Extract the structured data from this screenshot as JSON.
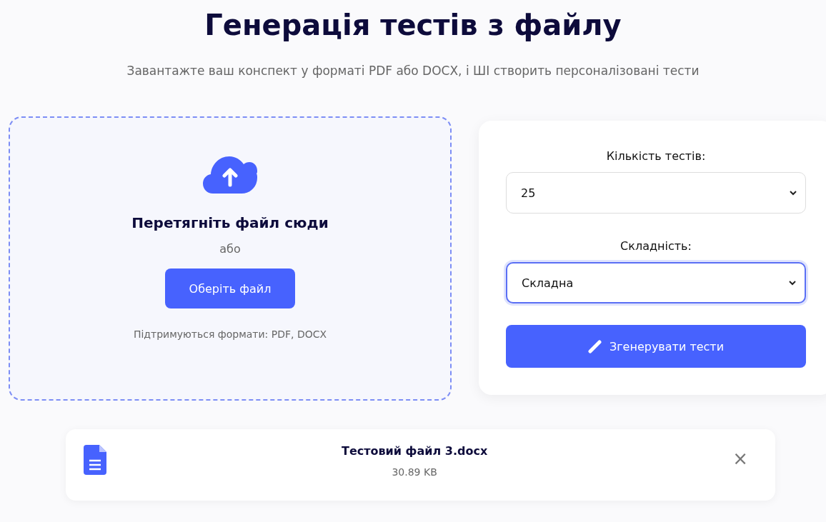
{
  "header": {
    "title": "Генерація тестів з файлу",
    "subtitle": "Завантажте ваш конспект у форматі PDF або DOCX, і ШІ створить персоналізовані тести"
  },
  "upload": {
    "heading": "Перетягніть файл сюди",
    "or": "або",
    "button": "Оберіть файл",
    "formats": "Підтримуються формати: PDF, DOCX"
  },
  "settings": {
    "fields": [
      {
        "label": "Кількість тестів:",
        "value": "25",
        "focused": false
      },
      {
        "label": "Складність:",
        "value": "Складна",
        "focused": true
      }
    ],
    "button": "Згенерувати тести"
  },
  "file": {
    "name": "Тестовий файл 3.docx",
    "size": "30.89 KB",
    "close": "×"
  }
}
